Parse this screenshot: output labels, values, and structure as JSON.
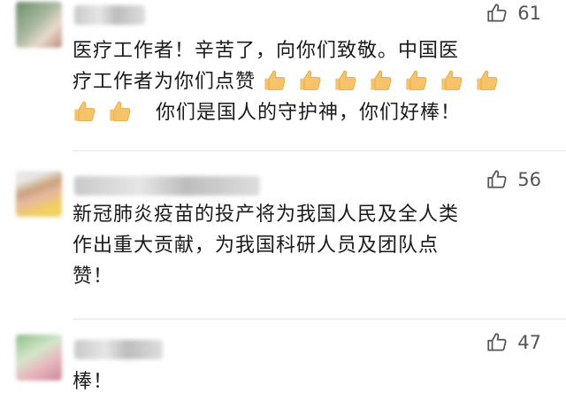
{
  "comments": [
    {
      "likes": "61",
      "text_line1": "医疗工作者！辛苦了，向你们致敬。中国医",
      "text_line2_prefix": "疗工作者为你们点赞",
      "text_line3": "你们是国人的守护神，你们好棒！",
      "thumb_emoji_count": 9
    },
    {
      "likes": "56",
      "text_line1": "新冠肺炎疫苗的投产将为我国人民及全人类",
      "text_line2": "作出重大贡献，为我国科研人员及团队点",
      "text_line3": "赞！"
    },
    {
      "likes": "47",
      "text_line1": "棒！"
    }
  ],
  "icons": {
    "like": "thumbs-up-outline-icon",
    "emoji": "thumbs-up-emoji-icon"
  },
  "colors": {
    "emoji_fill": "#f6c36b",
    "like_gray": "#555555"
  }
}
